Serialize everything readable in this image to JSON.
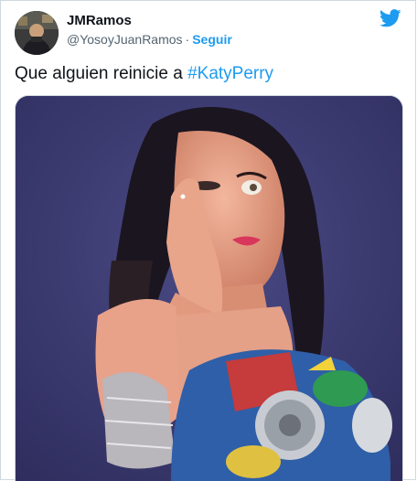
{
  "author": {
    "name": "JMRamos",
    "handle": "@YosoyJuanRamos",
    "separator": "·",
    "follow_label": "Seguir"
  },
  "tweet": {
    "text": "Que alguien reinicie a ",
    "hashtag": "#KatyPerry"
  },
  "icons": {
    "brand": "twitter-bird-icon"
  },
  "colors": {
    "accent": "#1d9bf0",
    "text": "#0f1419",
    "muted": "#536471",
    "border": "#cfd9de"
  }
}
